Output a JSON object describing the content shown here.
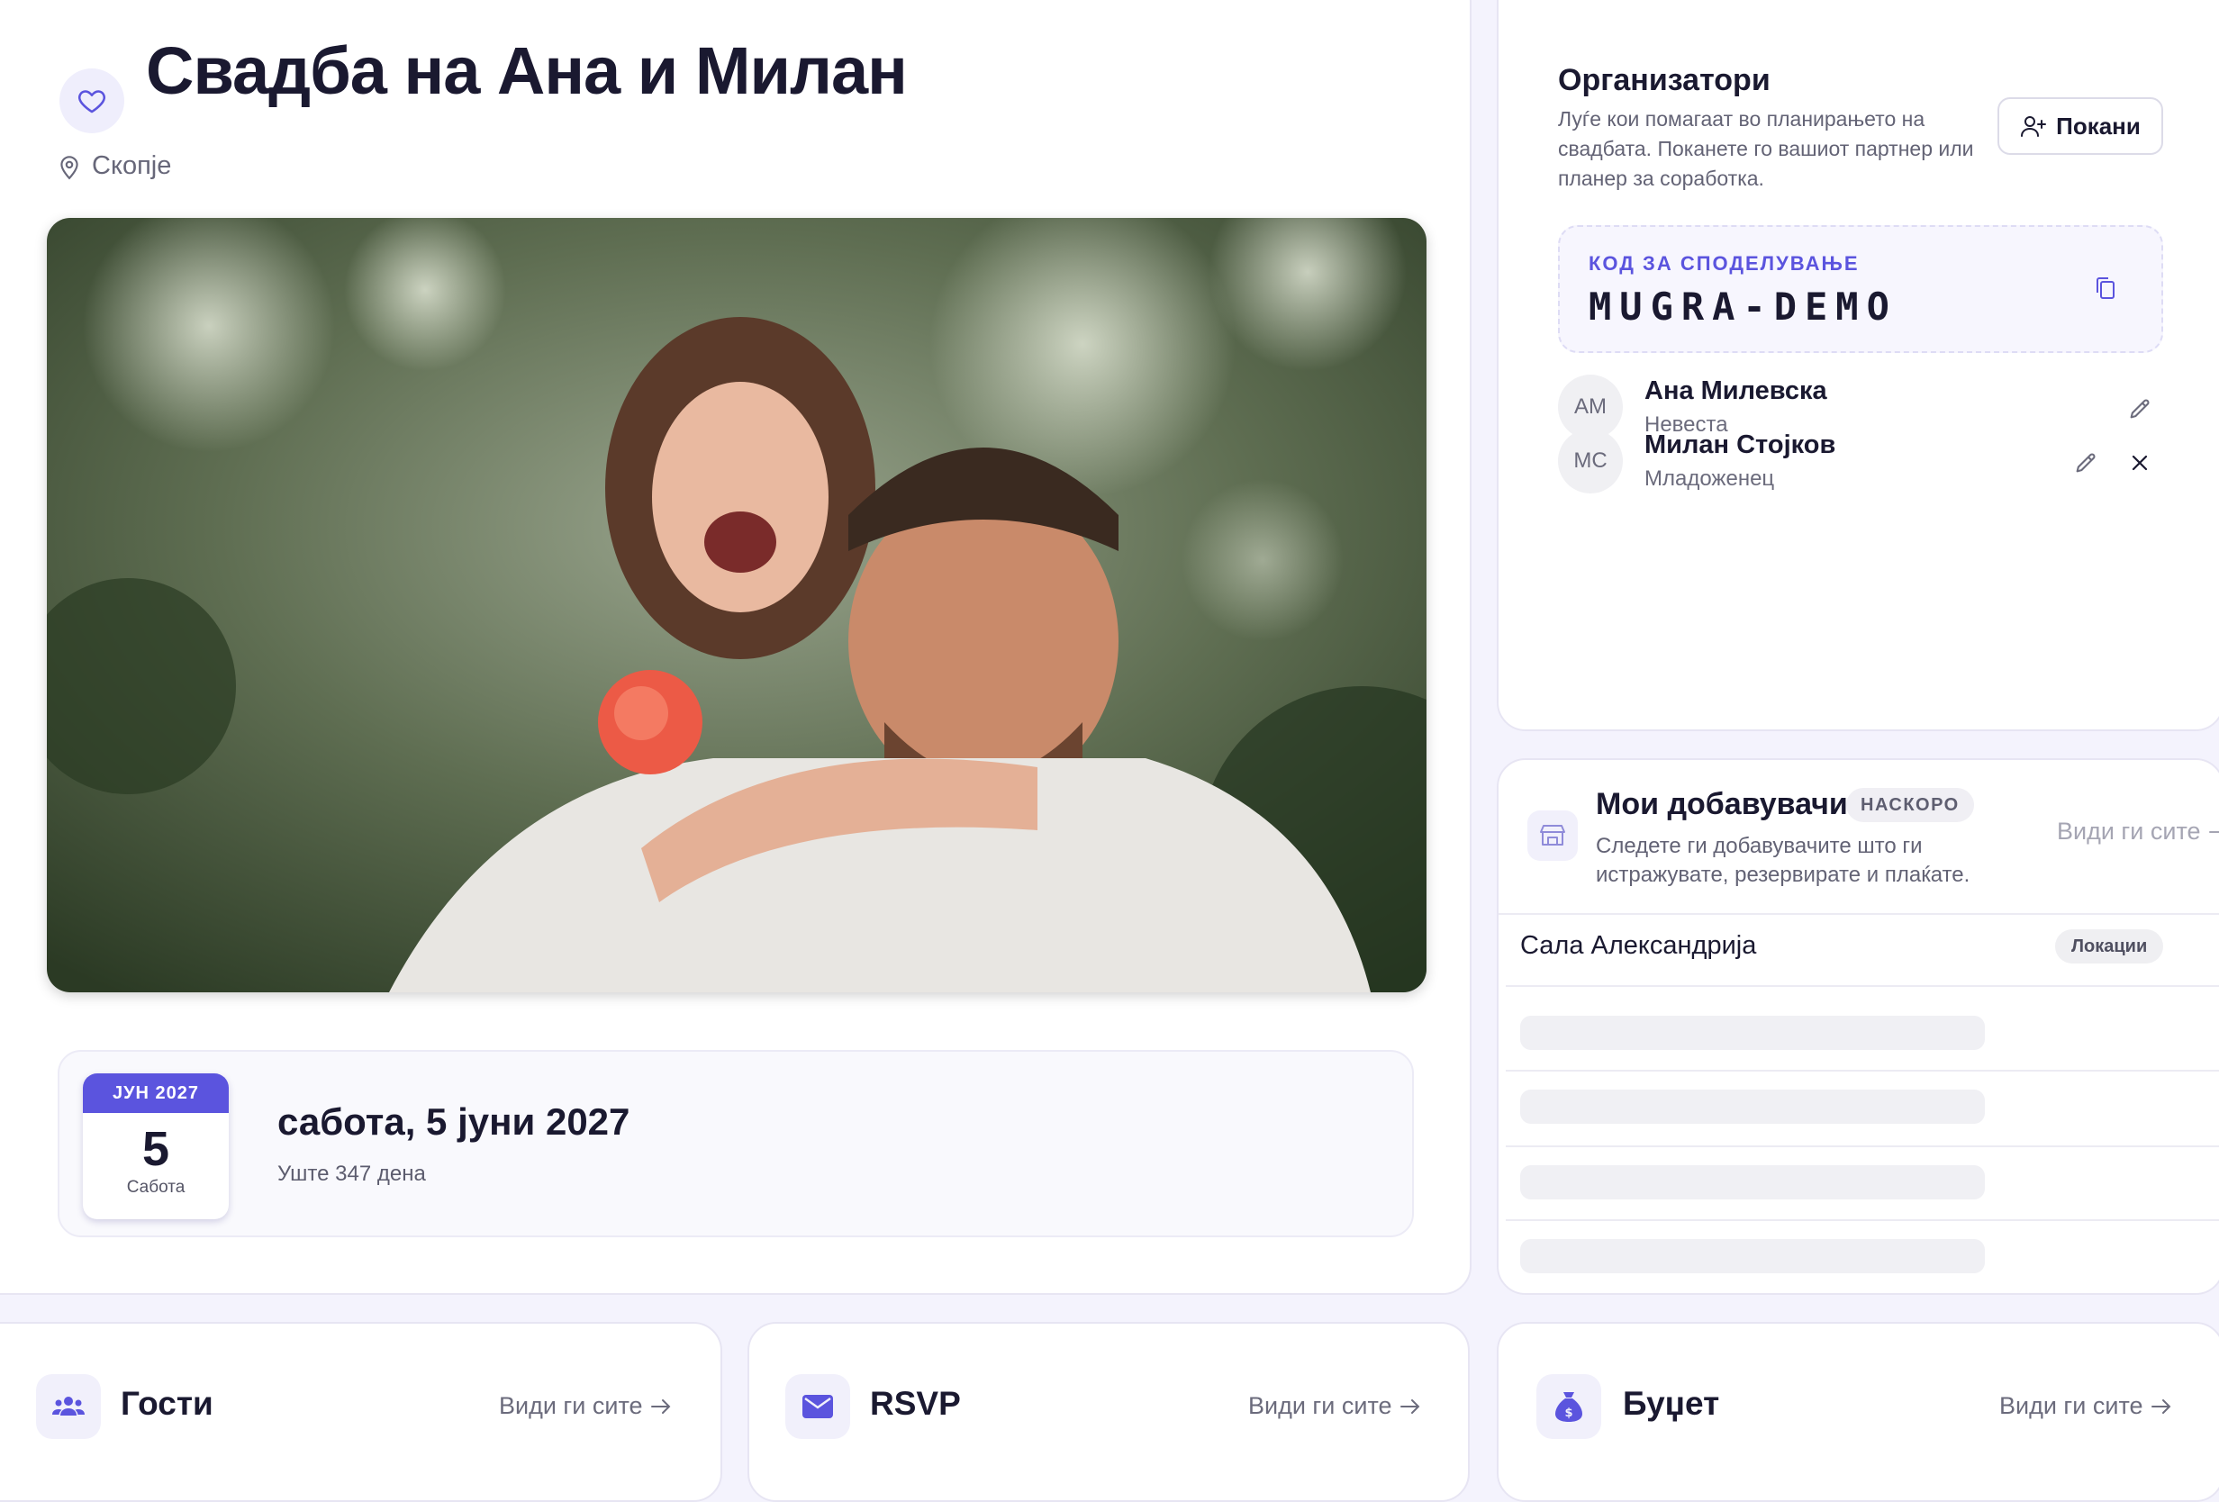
{
  "wedding": {
    "title": "Свадба на Ана и Милан",
    "location": "Скопје",
    "photo_alt": "Couple photo",
    "calendar": {
      "month": "ЈУН 2027",
      "day": "5",
      "weekday": "Сабота"
    },
    "date_full": "сабота, 5 јуни 2027",
    "countdown": "Уште 347 дена"
  },
  "organizers": {
    "title": "Организатори",
    "description": "Луѓе кои помагаат во планирањето на свадбата. Поканете го вашиот партнер или планер за соработка.",
    "invite_label": "Покани",
    "share": {
      "label": "КОД ЗА СПОДЕЛУВАЊЕ",
      "code": "MUGRA-DEMO"
    },
    "people": [
      {
        "initials": "АМ",
        "name": "Ана Милевска",
        "role": "Невеста"
      },
      {
        "initials": "МС",
        "name": "Милан Стојков",
        "role": "Младоженец"
      }
    ]
  },
  "vendors": {
    "title": "Мои добавувачи",
    "badge": "НАСКОРО",
    "description": "Следете ги добавувачите што ги истражувате, резервирате и плаќате.",
    "see_all": "Види ги сите",
    "rows": [
      {
        "name": "Сала Александрија",
        "tag": "Локации"
      }
    ]
  },
  "cards": [
    {
      "title": "Гости",
      "see_all": "Види ги сите",
      "icon": "users-icon"
    },
    {
      "title": "RSVP",
      "see_all": "Види ги сите",
      "icon": "envelope-icon"
    },
    {
      "title": "Буџет",
      "see_all": "Види ги сите",
      "icon": "money-bag-icon"
    }
  ],
  "colors": {
    "accent": "#5b54de",
    "background": "#f4f3fd"
  }
}
